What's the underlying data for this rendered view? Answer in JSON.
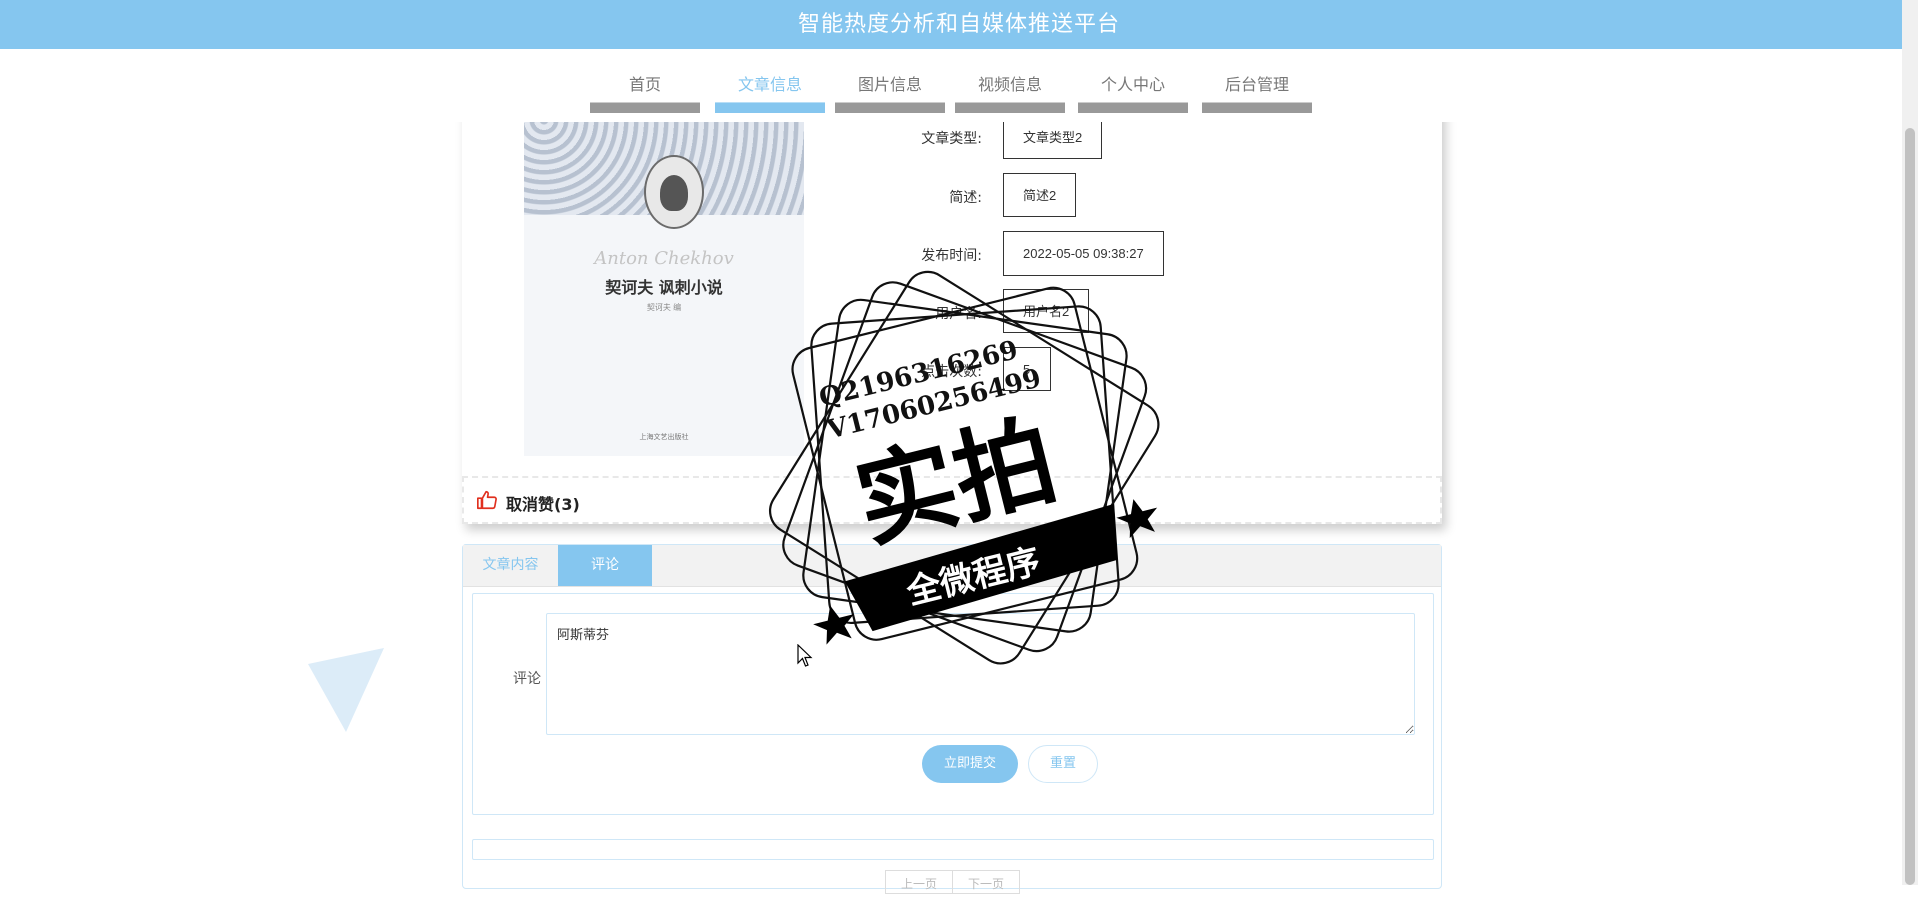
{
  "header": {
    "title": "智能热度分析和自媒体推送平台"
  },
  "nav": [
    {
      "label": "首页",
      "active": false
    },
    {
      "label": "文章信息",
      "active": true
    },
    {
      "label": "图片信息",
      "active": false
    },
    {
      "label": "视频信息",
      "active": false
    },
    {
      "label": "个人中心",
      "active": false
    },
    {
      "label": "后台管理",
      "active": false
    }
  ],
  "cover": {
    "script_text": "Anton Chekhov",
    "title": "契诃夫  讽刺小说",
    "subtitle": "契诃夫 编",
    "publisher": "上海文艺出版社"
  },
  "fields": [
    {
      "label": "文章类型:",
      "value": "文章类型2"
    },
    {
      "label": "简述:",
      "value": "简述2"
    },
    {
      "label": "发布时间:",
      "value": "2022-05-05 09:38:27"
    },
    {
      "label": "用户名:",
      "value": "用户名2"
    },
    {
      "label": "点击次数:",
      "value": "5"
    }
  ],
  "like": {
    "label": "取消赞(3)"
  },
  "tabs": [
    {
      "label": "文章内容",
      "active": false
    },
    {
      "label": "评论",
      "active": true
    }
  ],
  "comment_form": {
    "label": "评论",
    "value": "阿斯蒂芬",
    "submit_label": "立即提交",
    "reset_label": "重置"
  },
  "pager": {
    "prev_label": "上一页",
    "next_label": "下一页"
  },
  "watermark": {
    "line1": "Q2196316269",
    "line2": "V17060256499",
    "main": "实拍",
    "ribbon": "全微程序"
  },
  "colors": {
    "accent": "#85c6ef",
    "nav_bar": "#999999"
  }
}
